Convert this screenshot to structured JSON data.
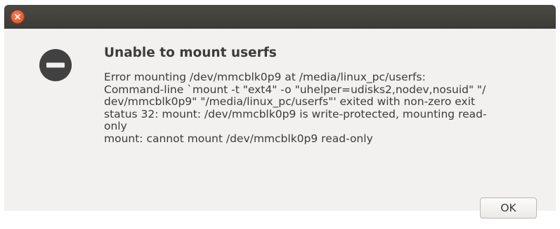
{
  "window": {
    "close_icon": "close-icon",
    "titlebar_color": "#3c3b37",
    "close_color": "#df4a16"
  },
  "dialog": {
    "icon": "error-icon",
    "title": "Unable to mount userfs",
    "message_lines": [
      "Error mounting /dev/mmcblk0p9 at /media/linux_pc/userfs:",
      "Command-line `mount -t \"ext4\" -o \"uhelper=udisks2,nodev,nosuid\" \"/",
      "dev/mmcblk0p9\" \"/media/linux_pc/userfs\"' exited with non-zero exit",
      "status 32: mount: /dev/mmcblk0p9 is write-protected, mounting read-",
      "only",
      "mount: cannot mount /dev/mmcblk0p9 read-only"
    ],
    "ok_label": "OK"
  }
}
